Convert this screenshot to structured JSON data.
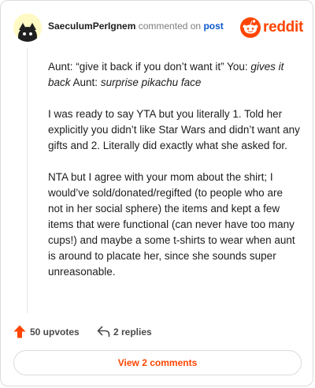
{
  "comment": {
    "username": "SaeculumPerIgnem",
    "action_text": "commented on",
    "post_link": "post",
    "brand": "reddit",
    "body": {
      "p1_a": "Aunt: “give it back if you don’t want it” You: ",
      "p1_b": "gives it back",
      "p1_c": " Aunt: ",
      "p1_d": "surprise pikachu face",
      "p2": "I was ready to say YTA but you literally 1. Told her explicitly you didn’t like Star Wars and didn’t want any gifts and 2. Literally did exactly what she asked for.",
      "p3": "NTA but I agree with your mom about the shirt; I would’ve sold/donated/regifted (to people who are not in her social sphere) the items and kept a few items that were functional (can never have too many cups!) and maybe a some t-shirts to wear when aunt is around to placate her, since she sounds super unreasonable."
    },
    "upvotes": "50 upvotes",
    "replies": "2 replies",
    "view_button": "View 2 comments"
  },
  "colors": {
    "brand": "#ff4500",
    "link": "#0b57d0",
    "avatar_bg": "#fff9c4"
  },
  "icons": {
    "avatar": "black-cat-avatar",
    "brand": "reddit-snoo-icon",
    "upvote": "upvote-arrow-icon",
    "reply": "reply-arrow-icon"
  }
}
